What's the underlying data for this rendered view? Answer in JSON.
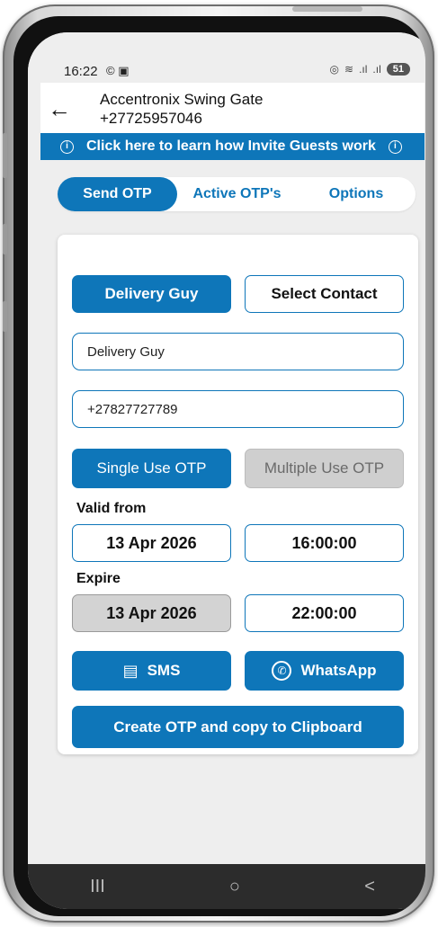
{
  "status_bar": {
    "time": "16:22",
    "left_icons": "© ▣",
    "battery": "51"
  },
  "header": {
    "title": "Accentronix Swing Gate",
    "phone": "+27725957046"
  },
  "banner": {
    "text": "Click here to learn how Invite Guests work"
  },
  "tabs": [
    {
      "label": "Send OTP",
      "active": true
    },
    {
      "label": "Active OTP's",
      "active": false
    },
    {
      "label": "Options",
      "active": false
    }
  ],
  "form": {
    "preset_button": "Delivery Guy",
    "select_contact_button": "Select Contact",
    "name_value": "Delivery Guy",
    "phone_value": "+27827727789",
    "single_use_label": "Single Use OTP",
    "multiple_use_label": "Multiple Use OTP",
    "valid_from_label": "Valid from",
    "valid_from_date": "13 Apr 2026",
    "valid_from_time": "16:00:00",
    "expire_label": "Expire",
    "expire_date": "13 Apr 2026",
    "expire_time": "22:00:00",
    "sms_label": "SMS",
    "whatsapp_label": "WhatsApp",
    "create_button": "Create OTP and copy to Clipboard"
  },
  "nav": {
    "recents": "III",
    "home": "○",
    "back": "<"
  },
  "colors": {
    "accent": "#0e76b9",
    "disabled": "#cfcfcf"
  }
}
